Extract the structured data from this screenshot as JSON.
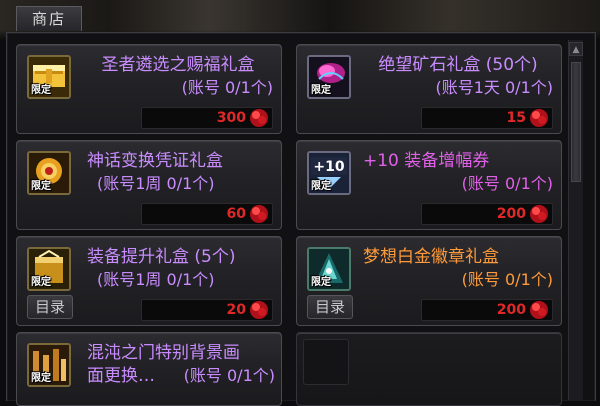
{
  "window": {
    "title": "商店"
  },
  "items": [
    {
      "name": "圣者遴选之赐福礼盒",
      "limit": "(账号 0/1个)",
      "price": "300",
      "badge": "限定",
      "icon_name": "gold-chest-icon",
      "name_color": "#c98cff"
    },
    {
      "name": "绝望矿石礼盒 (50个)",
      "limit": "(账号1天 0/1个)",
      "price": "15",
      "badge": "限定",
      "icon_name": "ore-crystal-icon",
      "name_color": "#c98cff"
    },
    {
      "name": "神话变换凭证礼盒",
      "limit": "(账号1周 0/1个)",
      "price": "60",
      "badge": "限定",
      "icon_name": "mythic-voucher-icon",
      "name_color": "#c98cff"
    },
    {
      "name": "+10 装备增幅券",
      "limit": "(账号 0/1个)",
      "price": "200",
      "badge": "限定",
      "badge_top": "+10",
      "icon_name": "amplify-ticket-icon",
      "name_color": "#e060e8"
    },
    {
      "name": "装备提升礼盒 (5个)",
      "limit": "(账号1周 0/1个)",
      "price": "20",
      "badge": "限定",
      "icon_name": "upgrade-box-icon",
      "name_color": "#c98cff"
    },
    {
      "name": "梦想白金徽章礼盒",
      "limit": "(账号 0/1个)",
      "price": "200",
      "badge": "限定",
      "icon_name": "platinum-emblem-icon",
      "name_color": "#ff9a3a"
    },
    {
      "name": "混沌之门特别背景画",
      "name_line2": "面更换…",
      "limit": "(账号 0/1个)",
      "badge": "限定",
      "icon_name": "background-change-icon",
      "name_color": "#c98cff"
    }
  ],
  "catalog_label": "目录",
  "colors": {
    "price": "#e02828",
    "panel_border": "#4a4a50"
  }
}
